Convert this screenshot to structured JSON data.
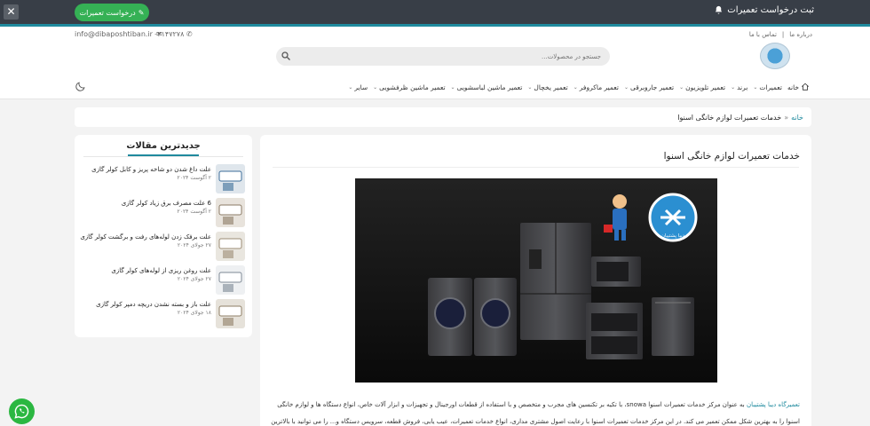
{
  "topbar": {
    "close_icon": "close-icon",
    "request_button": "درخواست تعمیرات",
    "notice": "ثبت درخواست تعمیرات",
    "accent": "#1f8a9e"
  },
  "header": {
    "email": "info@dibaposhtiban.ir",
    "phone": "۰۲۱۴۷۲۷۸",
    "links": [
      "درباره ما",
      "تماس با ما"
    ],
    "search_placeholder": "جستجو در محصولات...",
    "nav": [
      {
        "label": "خانه",
        "chevron": false
      },
      {
        "label": "تعمیرات",
        "chevron": true
      },
      {
        "label": "برند",
        "chevron": true
      },
      {
        "label": "تعمیر تلویزیون",
        "chevron": true
      },
      {
        "label": "تعمیر جاروبرقی",
        "chevron": true
      },
      {
        "label": "تعمیر ماکروفر",
        "chevron": true
      },
      {
        "label": "تعمیر یخچال",
        "chevron": true
      },
      {
        "label": "تعمیر ماشین لباسشویی",
        "chevron": true
      },
      {
        "label": "تعمیر ماشین ظرفشویی",
        "chevron": true
      },
      {
        "label": "سایر",
        "chevron": true
      }
    ]
  },
  "breadcrumb": {
    "home": "خانه",
    "separator": "»",
    "current": "خدمات تعمیرات لوازم خانگی اسنوا"
  },
  "sidebar": {
    "title": "جدیدترین مقالات",
    "articles": [
      {
        "title": "علت داغ شدن دو شاخه پریز و کابل کولر گازی",
        "date": "۲ آگوست ۲۰۲۴"
      },
      {
        "title": "6 علت مصرف برق زیاد کولر گازی",
        "date": "۲ آگوست ۲۰۲۴"
      },
      {
        "title": "علت برفک زدن لوله‌های رفت و برگشت کولر گازی",
        "date": "۲۷ جولای ۲۰۲۴"
      },
      {
        "title": "علت روغن ریزی از لوله‌های کولر گازی",
        "date": "۲۷ جولای ۲۰۲۴"
      },
      {
        "title": "علت باز و بسته نشدن دریچه دمپر کولر گازی",
        "date": "۱۸ جولای ۲۰۲۴"
      }
    ]
  },
  "main": {
    "title": "خدمات تعمیرات لوازم خانگی اسنوا",
    "logo_caption": "دیبا پشتیبان",
    "para1_link": "تعمیرگاه دیبا پشتیبان",
    "para1_text": " به عنوان مرکز خدمات تعمیرات اسنوا snowa، با تکیه بر تکنسین های مجرب و متخصص و با استفاده از قطعات اورجینال و تجهیزات و ابزار آلات خاص، انواع دستگاه ها و لوازم خانگی",
    "para2_text": "اسنوا را به بهترین شکل ممکن تعمیر می کند. در این مرکز خدمات تعمیرات اسنوا با رعایت اصول مشتری مداری، انواع خدمات تعمیرات، عیب یابی، فروش قطعه، سرویس دستگاه و... را می توانید با بالاترین"
  },
  "whatsapp": {
    "icon": "whatsapp-icon"
  }
}
